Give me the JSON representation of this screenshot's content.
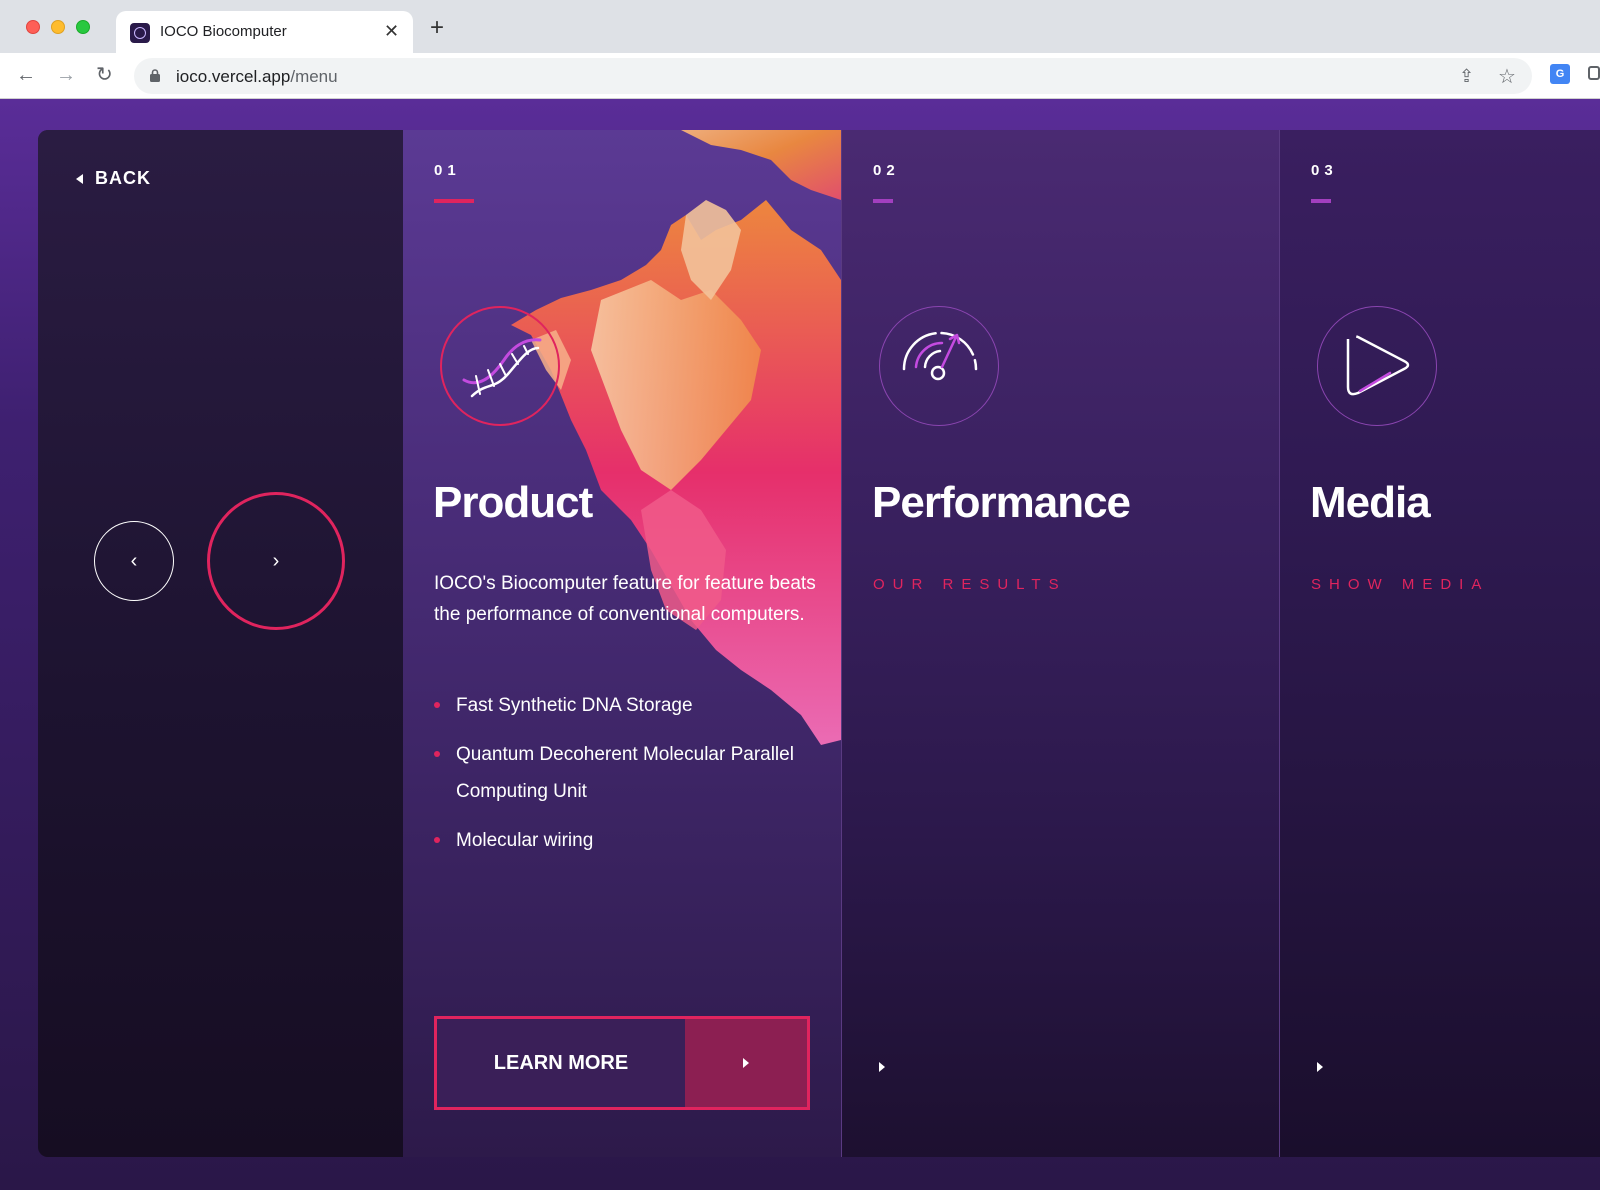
{
  "browser": {
    "tab_title": "IOCO Biocomputer",
    "url_host": "ioco.vercel.app",
    "url_path": "/menu",
    "close_glyph": "✕",
    "new_tab_glyph": "+",
    "back_glyph": "←",
    "forward_glyph": "→",
    "reload_glyph": "↻",
    "share_glyph": "⇪",
    "star_glyph": "☆",
    "translate_glyph": "G"
  },
  "nav": {
    "back_label": "BACK",
    "prev_glyph": "‹",
    "next_glyph": "›"
  },
  "panels": [
    {
      "number": "01",
      "title": "Product",
      "icon": "dna-icon",
      "description": "IOCO's Biocomputer feature for feature beats the performance of conventional computers.",
      "features": [
        "Fast Synthetic DNA Storage",
        "Quantum Decoherent Molecular Parallel Computing Unit",
        "Molecular wiring"
      ],
      "cta_label": "LEARN MORE"
    },
    {
      "number": "02",
      "title": "Performance",
      "icon": "speedometer-icon",
      "subtitle": "OUR RESULTS"
    },
    {
      "number": "03",
      "title": "Media",
      "icon": "play-icon",
      "subtitle": "SHOW MEDIA"
    }
  ],
  "colors": {
    "accent": "#e0245e",
    "purple_accent": "#a23fbf",
    "background": "#2a1748"
  }
}
